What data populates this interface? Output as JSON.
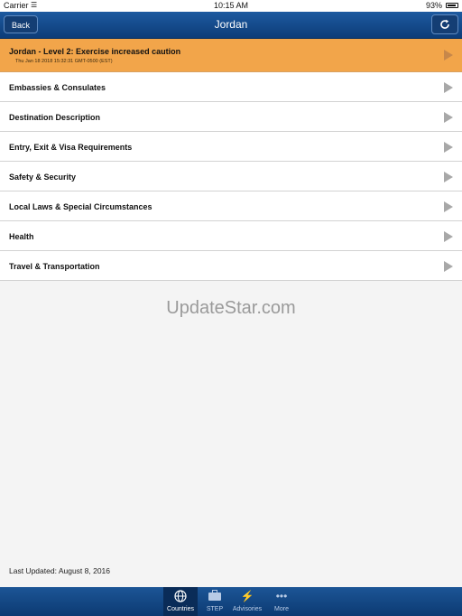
{
  "status_bar": {
    "carrier": "Carrier",
    "time": "10:15 AM",
    "battery": "93%"
  },
  "nav": {
    "back_label": "Back",
    "title": "Jordan"
  },
  "alert": {
    "title": "Jordan - Level 2: Exercise increased caution",
    "timestamp": "Thu Jan 18 2018 15:32:31 GMT-0500 (EST)"
  },
  "list_items": [
    {
      "label": "Embassies & Consulates"
    },
    {
      "label": "Destination Description"
    },
    {
      "label": "Entry, Exit & Visa Requirements"
    },
    {
      "label": "Safety & Security"
    },
    {
      "label": "Local Laws & Special Circumstances"
    },
    {
      "label": "Health"
    },
    {
      "label": "Travel & Transportation"
    }
  ],
  "watermark": "UpdateStar.com",
  "last_updated": "Last Updated: August 8, 2016",
  "tabs": [
    {
      "label": "Countries",
      "icon": "globe-icon"
    },
    {
      "label": "STEP",
      "icon": "briefcase-icon"
    },
    {
      "label": "Advisories",
      "icon": "lightning-icon"
    },
    {
      "label": "More",
      "icon": "more-icon"
    }
  ],
  "colors": {
    "nav_bar": "#1d5aa0",
    "alert_row": "#f2a54a",
    "tab_bar": "#1c5596",
    "background": "#f4f4f4"
  }
}
